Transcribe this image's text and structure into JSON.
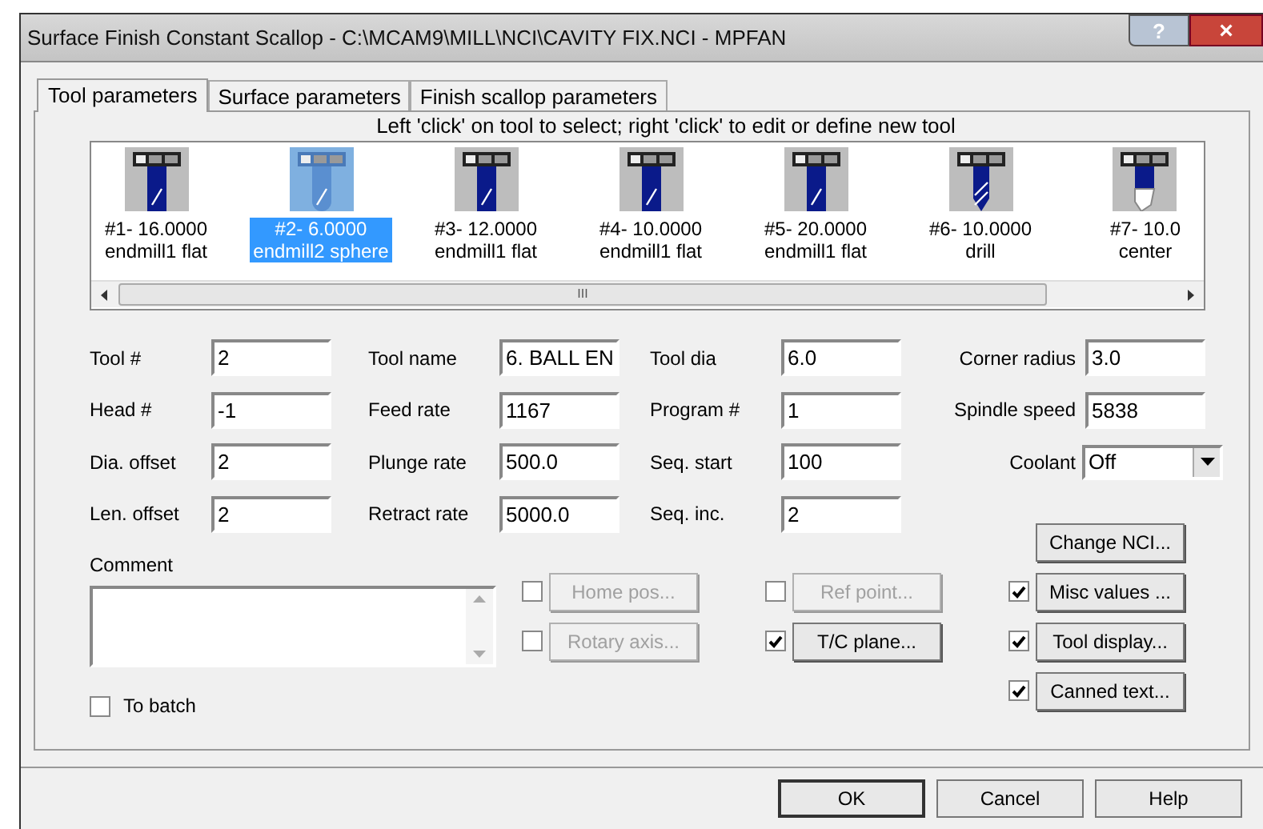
{
  "window": {
    "title": "Surface Finish Constant Scallop - C:\\MCAM9\\MILL\\NCI\\CAVITY FIX.NCI - MPFAN",
    "help_button": "?",
    "close_button": "×"
  },
  "tabs": [
    {
      "label": "Tool parameters",
      "selected": true
    },
    {
      "label": "Surface parameters",
      "selected": false
    },
    {
      "label": "Finish scallop parameters",
      "selected": false
    }
  ],
  "hint": "Left 'click' on tool to select; right 'click' to edit or define new tool",
  "tools": [
    {
      "line1": "#1- 16.0000",
      "line2": "endmill1 flat",
      "kind": "flat",
      "selected": false
    },
    {
      "line1": "#2- 6.0000",
      "line2": "endmill2 sphere",
      "kind": "sphere",
      "selected": true
    },
    {
      "line1": "#3- 12.0000",
      "line2": "endmill1 flat",
      "kind": "flat",
      "selected": false
    },
    {
      "line1": "#4- 10.0000",
      "line2": "endmill1 flat",
      "kind": "flat",
      "selected": false
    },
    {
      "line1": "#5- 20.0000",
      "line2": "endmill1 flat",
      "kind": "flat",
      "selected": false
    },
    {
      "line1": "#6- 10.0000",
      "line2": "drill",
      "kind": "drill",
      "selected": false
    },
    {
      "line1": "#7- 10.0",
      "line2": "center",
      "kind": "center",
      "selected": false
    }
  ],
  "scrollbar_grip": "III",
  "fields": [
    [
      {
        "label": "Tool #",
        "value": "2"
      },
      {
        "label": "Tool name",
        "value": "6. BALL EN"
      },
      {
        "label": "Tool dia",
        "value": "6.0"
      },
      {
        "label": "Corner radius",
        "value": "3.0",
        "kind": "input"
      }
    ],
    [
      {
        "label": "Head #",
        "value": "-1"
      },
      {
        "label": "Feed rate",
        "value": "1167"
      },
      {
        "label": "Program #",
        "value": "1"
      },
      {
        "label": "Spindle speed",
        "value": "5838",
        "kind": "input"
      }
    ],
    [
      {
        "label": "Dia. offset",
        "value": "2"
      },
      {
        "label": "Plunge rate",
        "value": "500.0"
      },
      {
        "label": "Seq. start",
        "value": "100"
      },
      {
        "label": "Coolant",
        "value": "Off",
        "kind": "select"
      }
    ],
    [
      {
        "label": "Len. offset",
        "value": "2"
      },
      {
        "label": "Retract rate",
        "value": "5000.0"
      },
      {
        "label": "Seq. inc.",
        "value": "2"
      }
    ]
  ],
  "change_nci": "Change NCI...",
  "comment": {
    "label": "Comment"
  },
  "option_buttons": [
    [
      {
        "label": "Home pos...",
        "checked": false,
        "disabled": true
      },
      {
        "label": "Ref point...",
        "checked": false,
        "disabled": true
      },
      {
        "label": "Misc values ...",
        "checked": true,
        "disabled": false
      }
    ],
    [
      {
        "label": "Rotary axis...",
        "checked": false,
        "disabled": true
      },
      {
        "label": "T/C plane...",
        "checked": true,
        "disabled": false
      },
      {
        "label": "Tool display...",
        "checked": true,
        "disabled": false
      }
    ],
    [
      {
        "label": "Canned text...",
        "checked": true,
        "disabled": false
      }
    ]
  ],
  "to_batch": {
    "label": "To batch",
    "checked": false
  },
  "buttons": [
    "OK",
    "Cancel",
    "Help"
  ]
}
